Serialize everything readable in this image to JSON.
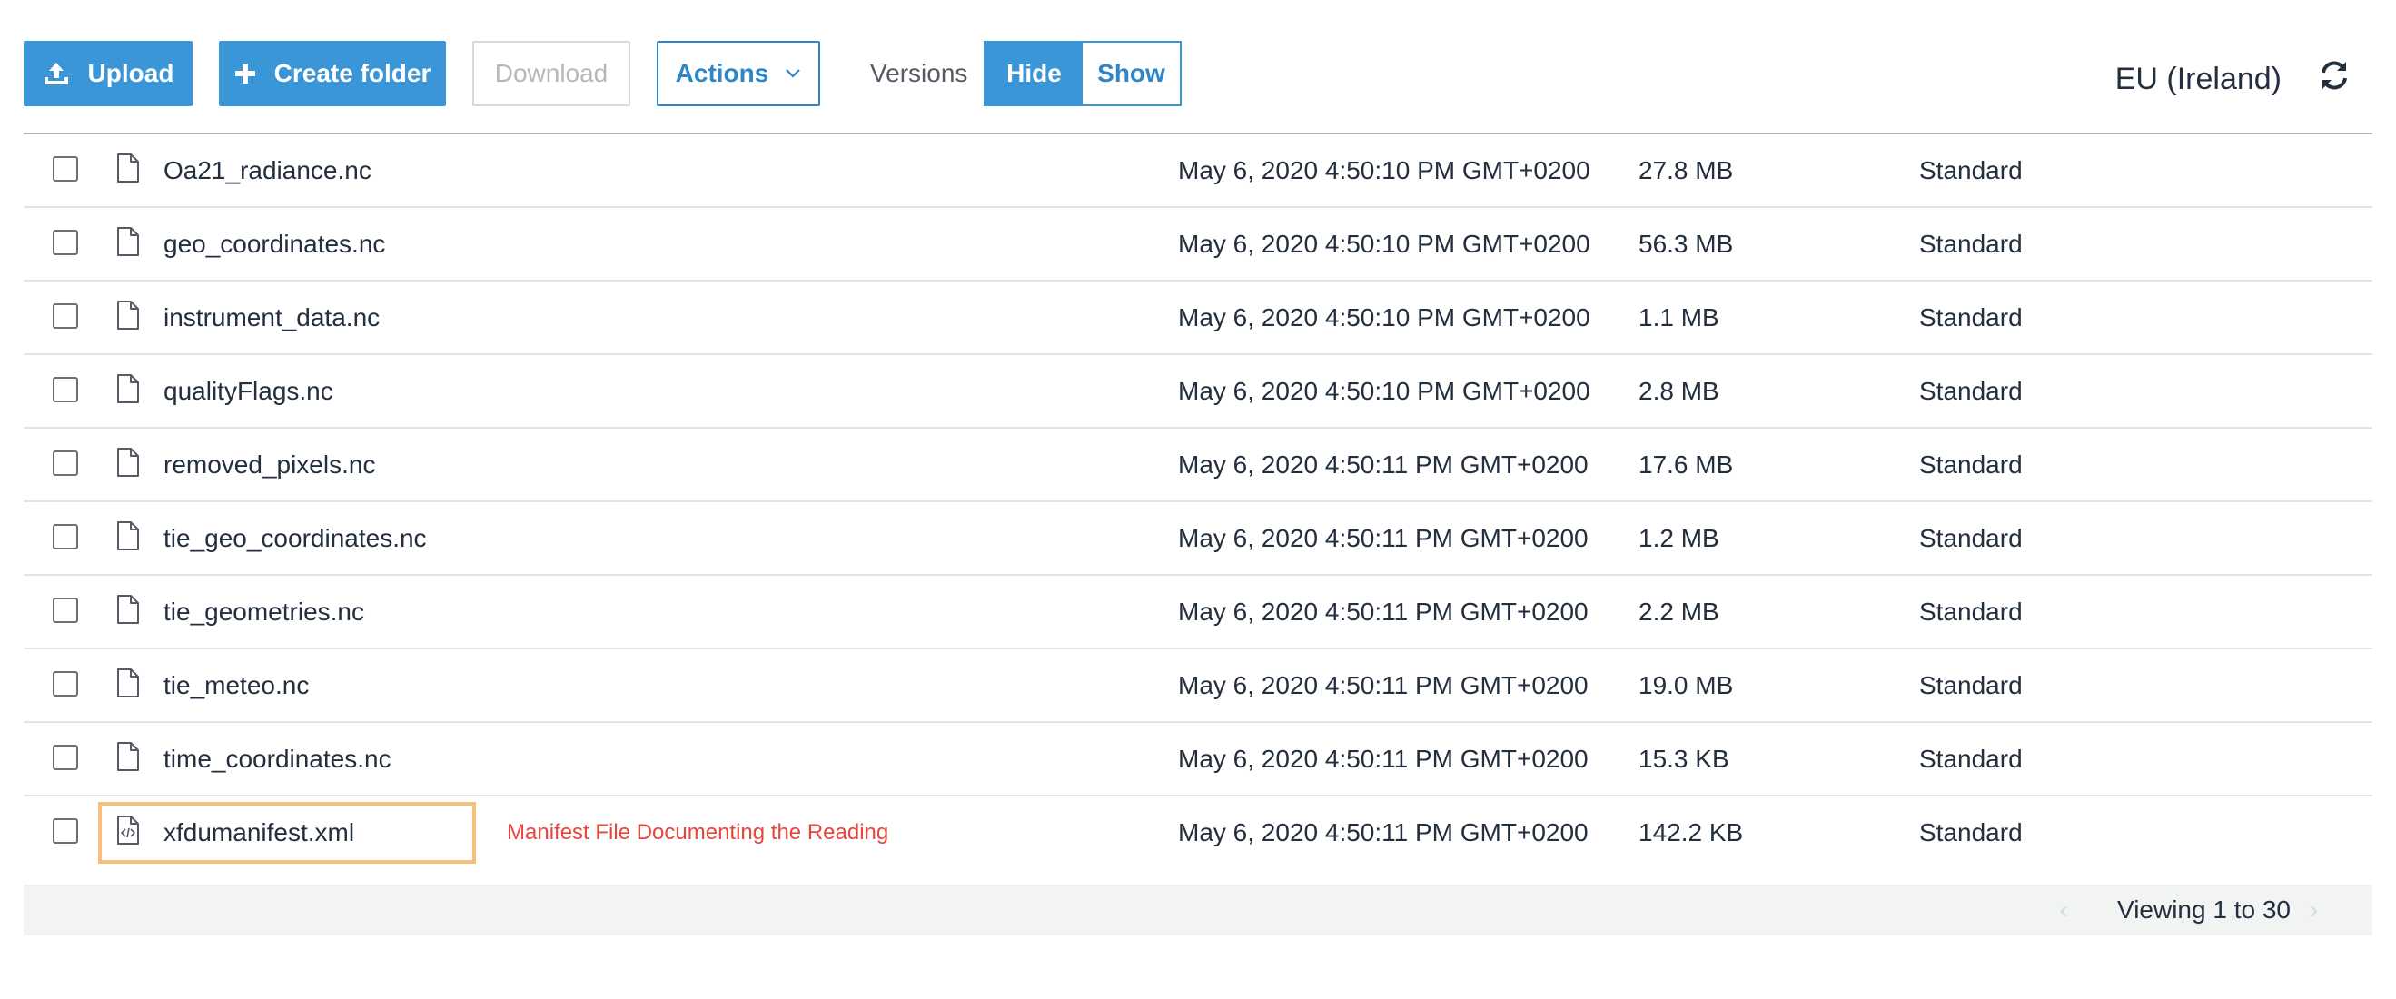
{
  "toolbar": {
    "upload_label": "Upload",
    "create_folder_label": "Create folder",
    "download_label": "Download",
    "actions_label": "Actions",
    "versions_label": "Versions",
    "versions_hide": "Hide",
    "versions_show": "Show",
    "region": "EU (Ireland)"
  },
  "colors": {
    "accent": "#3b96d8",
    "highlight_border": "#f7c07a",
    "annotation": "#e8453c"
  },
  "files": [
    {
      "name": "Oa21_radiance.nc",
      "date": "May 6, 2020 4:50:10 PM GMT+0200",
      "size": "27.8 MB",
      "storage_class": "Standard",
      "icon": "file-icon"
    },
    {
      "name": "geo_coordinates.nc",
      "date": "May 6, 2020 4:50:10 PM GMT+0200",
      "size": "56.3 MB",
      "storage_class": "Standard",
      "icon": "file-icon"
    },
    {
      "name": "instrument_data.nc",
      "date": "May 6, 2020 4:50:10 PM GMT+0200",
      "size": "1.1 MB",
      "storage_class": "Standard",
      "icon": "file-icon"
    },
    {
      "name": "qualityFlags.nc",
      "date": "May 6, 2020 4:50:10 PM GMT+0200",
      "size": "2.8 MB",
      "storage_class": "Standard",
      "icon": "file-icon"
    },
    {
      "name": "removed_pixels.nc",
      "date": "May 6, 2020 4:50:11 PM GMT+0200",
      "size": "17.6 MB",
      "storage_class": "Standard",
      "icon": "file-icon"
    },
    {
      "name": "tie_geo_coordinates.nc",
      "date": "May 6, 2020 4:50:11 PM GMT+0200",
      "size": "1.2 MB",
      "storage_class": "Standard",
      "icon": "file-icon"
    },
    {
      "name": "tie_geometries.nc",
      "date": "May 6, 2020 4:50:11 PM GMT+0200",
      "size": "2.2 MB",
      "storage_class": "Standard",
      "icon": "file-icon"
    },
    {
      "name": "tie_meteo.nc",
      "date": "May 6, 2020 4:50:11 PM GMT+0200",
      "size": "19.0 MB",
      "storage_class": "Standard",
      "icon": "file-icon"
    },
    {
      "name": "time_coordinates.nc",
      "date": "May 6, 2020 4:50:11 PM GMT+0200",
      "size": "15.3 KB",
      "storage_class": "Standard",
      "icon": "file-icon"
    },
    {
      "name": "xfdumanifest.xml",
      "date": "May 6, 2020 4:50:11 PM GMT+0200",
      "size": "142.2 KB",
      "storage_class": "Standard",
      "icon": "code-file-icon",
      "annotation": "Manifest File Documenting the Reading"
    }
  ],
  "pagination": {
    "text": "Viewing 1 to 30"
  }
}
